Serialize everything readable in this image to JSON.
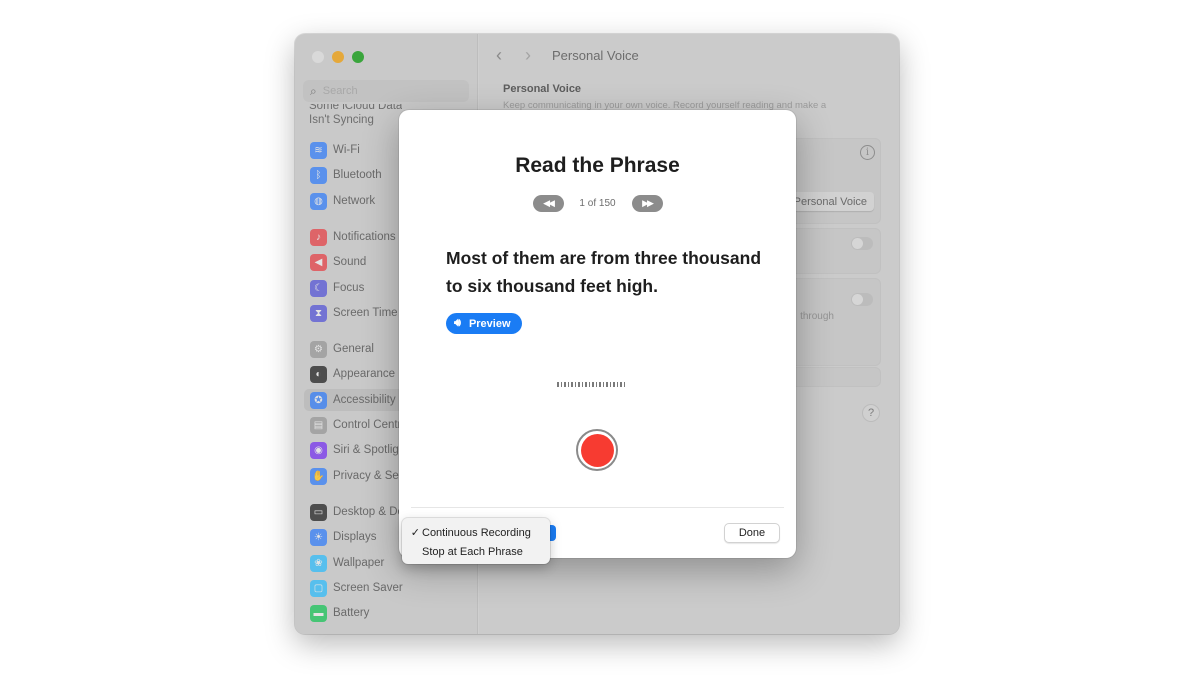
{
  "window": {
    "traffic_lights": [
      "close",
      "minimize",
      "zoom"
    ]
  },
  "sidebar": {
    "search_placeholder": "Search",
    "icloud_warning_line1": "Some iCloud Data",
    "icloud_warning_line2": "Isn't Syncing",
    "items": [
      {
        "label": "Wi-Fi",
        "icon": "wifi-icon",
        "glyph": "≋",
        "color": "#3b82f6"
      },
      {
        "label": "Bluetooth",
        "icon": "bluetooth-icon",
        "glyph": "ᛒ",
        "color": "#3b82f6"
      },
      {
        "label": "Network",
        "icon": "network-icon",
        "glyph": "◍",
        "color": "#3b82f6"
      },
      {
        "label": "Notifications",
        "icon": "bell-icon",
        "glyph": "♪",
        "color": "#e5484d"
      },
      {
        "label": "Sound",
        "icon": "speaker-icon",
        "glyph": "◀",
        "color": "#e5484d"
      },
      {
        "label": "Focus",
        "icon": "moon-icon",
        "glyph": "☾",
        "color": "#5b5bd6"
      },
      {
        "label": "Screen Time",
        "icon": "hourglass-icon",
        "glyph": "⧗",
        "color": "#5b5bd6"
      },
      {
        "label": "General",
        "icon": "gear-icon",
        "glyph": "⚙",
        "color": "#9a9a9a"
      },
      {
        "label": "Appearance",
        "icon": "appearance-icon",
        "glyph": "◐",
        "color": "#2b2b2b"
      },
      {
        "label": "Accessibility",
        "icon": "accessibility-icon",
        "glyph": "✪",
        "color": "#3b82f6"
      },
      {
        "label": "Control Centre",
        "icon": "control-centre-icon",
        "glyph": "▤",
        "color": "#9a9a9a"
      },
      {
        "label": "Siri & Spotlight",
        "icon": "siri-icon",
        "glyph": "◉",
        "color": "#7c3aed"
      },
      {
        "label": "Privacy & Security",
        "icon": "hand-icon",
        "glyph": "✋",
        "color": "#3b82f6"
      },
      {
        "label": "Desktop & Dock",
        "icon": "dock-icon",
        "glyph": "▭",
        "color": "#2b2b2b"
      },
      {
        "label": "Displays",
        "icon": "displays-icon",
        "glyph": "☀",
        "color": "#3b82f6"
      },
      {
        "label": "Wallpaper",
        "icon": "wallpaper-icon",
        "glyph": "❀",
        "color": "#38bdf8"
      },
      {
        "label": "Screen Saver",
        "icon": "screen-saver-icon",
        "glyph": "▢",
        "color": "#38bdf8"
      },
      {
        "label": "Battery",
        "icon": "battery-icon",
        "glyph": "▬",
        "color": "#22c55e"
      }
    ],
    "active_item": "Accessibility"
  },
  "main": {
    "title": "Personal Voice",
    "section_title": "Personal Voice",
    "section_desc": "Keep communicating in your own voice. Record yourself reading and make a",
    "create_button_label": "Create Personal Voice",
    "visible_fragment": "through"
  },
  "sheet": {
    "title": "Read the Phrase",
    "pager_text": "1 of 150",
    "current_phrase": 1,
    "total_phrases": 150,
    "phrase": "Most of them are from three thousand to six thousand feet high.",
    "preview_label": "Preview",
    "done_label": "Done",
    "accent_color": "#1a7cf4",
    "record_color": "#f73b31"
  },
  "menu": {
    "items": [
      {
        "label": "Continuous Recording",
        "checked": true,
        "check_glyph": "✓"
      },
      {
        "label": "Stop at Each Phrase",
        "checked": false,
        "check_glyph": ""
      }
    ]
  }
}
